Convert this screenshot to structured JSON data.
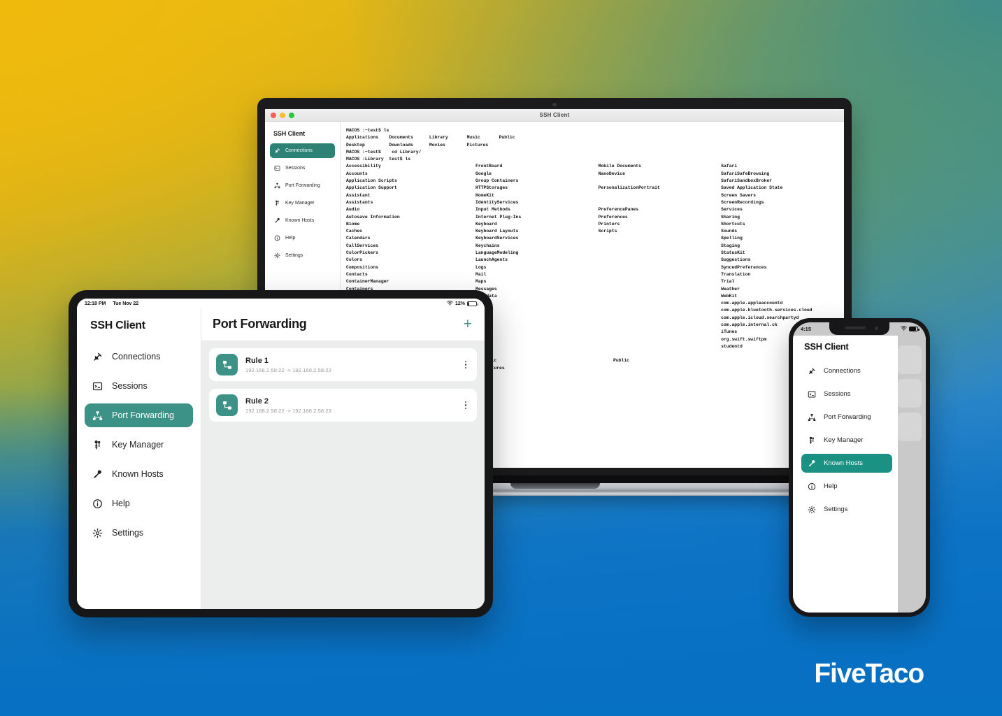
{
  "background": {
    "gradient_top_left": "#e8c21a",
    "gradient_top_right": "#3a8c8c",
    "gradient_bottom": "#0670c2"
  },
  "brand": {
    "logo_text": "FiveTaco",
    "accent": "#3d9287"
  },
  "laptop": {
    "window_title": "SSH Client",
    "app_title": "SSH Client",
    "nav": [
      {
        "label": "Connections",
        "icon": "plug-icon",
        "active": true
      },
      {
        "label": "Sessions",
        "icon": "terminal-icon",
        "active": false
      },
      {
        "label": "Port Forwarding",
        "icon": "network-node-icon",
        "active": false
      },
      {
        "label": "Key Manager",
        "icon": "key-ring-icon",
        "active": false
      },
      {
        "label": "Known Hosts",
        "icon": "key-icon",
        "active": false
      },
      {
        "label": "Help",
        "icon": "info-circle-icon",
        "active": false
      },
      {
        "label": "Settings",
        "icon": "gear-icon",
        "active": false
      }
    ],
    "terminal": {
      "line1": "MACOS :~test$ ls",
      "line2": "Applications    Documents      Library       Music       Public",
      "line3": "Desktop         Downloads      Movies        Pictures",
      "line4": "MACOS :~test$    cd Library/",
      "line5": "MACOS :Library  test$ ls",
      "col1": "Accessibility\nAccounts\nApplication Scripts\nApplication Support\nAssistant\nAssistants\nAudio\nAutosave Information\nBiome\nCaches\nCalendars\nCallServices\nColorPickers\nColors\nCompositions\nContacts\nContainerManager\nContainers\nCookies",
      "col2": "FrontBoard\nGoogle\nGroup Containers\nHTTPStorages\nHomeKit\nIdentityServices\nInput Methods\nInternet Plug-Ins\nKeyboard\nKeyboard Layouts\nKeyboardServices\nKeychains\nLanguageModeling\nLaunchAgents\nLogs\nMail\nMaps\nMessages\nMetadata",
      "col3": "Mobile Documents\nNanoDevice\n\nPersonalizationPortrait\n\n\nPreferencePanes\nPreferences\nPrinters\nScripts",
      "col4": "Safari\nSafariSafeBrowsing\nSafariSandboxBroker\nSaved Application State\nScreen Savers\nScreenRecordings\nServices\nSharing\nShortcuts\nSounds\nSpelling\nStaging\nStatusKit\nSuggestions\nSyncedPreferences\nTranslation\nTrial\nWeather\nWebKit\ncom.apple.appleaccountd\ncom.apple.bluetooth.services.cloud\ncom.apple.icloud.searchpartyd\ncom.apple.internal.ck\niTunes\norg.swift.swiftpm\nstudentd",
      "tail_col1": "Music\nPictures",
      "tail_col2": "Public"
    }
  },
  "tablet": {
    "status": {
      "time": "12:18 PM",
      "date": "Tue Nov 22",
      "wifi_icon": "wifi-icon",
      "battery_text": "12%"
    },
    "app_title": "SSH Client",
    "nav": [
      {
        "label": "Connections",
        "icon": "plug-icon",
        "active": false
      },
      {
        "label": "Sessions",
        "icon": "terminal-icon",
        "active": false
      },
      {
        "label": "Port Forwarding",
        "icon": "network-node-icon",
        "active": true
      },
      {
        "label": "Key Manager",
        "icon": "key-ring-icon",
        "active": false
      },
      {
        "label": "Known Hosts",
        "icon": "key-icon",
        "active": false
      },
      {
        "label": "Help",
        "icon": "info-circle-icon",
        "active": false
      },
      {
        "label": "Settings",
        "icon": "gear-icon",
        "active": false
      }
    ],
    "main": {
      "title": "Port Forwarding",
      "add_label": "+",
      "rules": [
        {
          "name": "Rule 1",
          "detail": "192.168.2.58:22 -> 192.168.2.58:23",
          "icon": "port-forward-icon"
        },
        {
          "name": "Rule 2",
          "detail": "192.168.2.58:22 -> 192.168.2.58:23",
          "icon": "port-forward-icon"
        }
      ]
    }
  },
  "phone": {
    "status": {
      "time": "4:15",
      "wifi_icon": "wifi-icon",
      "battery_icon": "battery-icon"
    },
    "app_title": "SSH Client",
    "nav": [
      {
        "label": "Connections",
        "icon": "plug-icon",
        "active": false
      },
      {
        "label": "Sessions",
        "icon": "terminal-icon",
        "active": false
      },
      {
        "label": "Port Forwarding",
        "icon": "network-node-icon",
        "active": false
      },
      {
        "label": "Key Manager",
        "icon": "key-ring-icon",
        "active": false
      },
      {
        "label": "Known Hosts",
        "icon": "key-icon",
        "active": true
      },
      {
        "label": "Help",
        "icon": "info-circle-icon",
        "active": false
      },
      {
        "label": "Settings",
        "icon": "gear-icon",
        "active": false
      }
    ]
  }
}
